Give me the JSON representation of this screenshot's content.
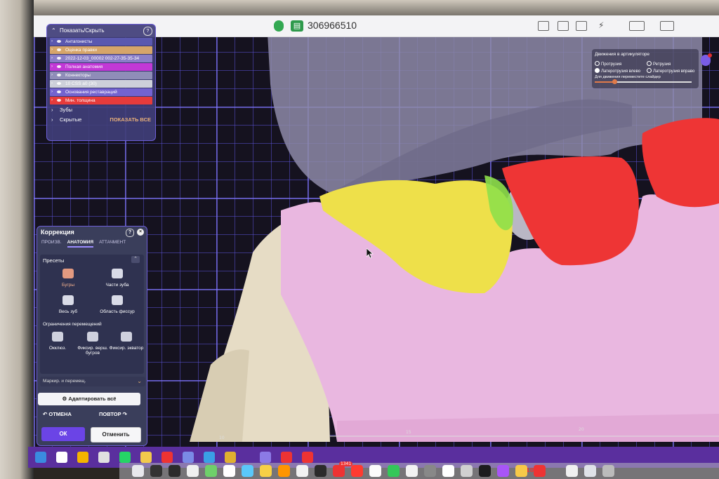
{
  "topbar": {
    "session_id": "306966510"
  },
  "visibility_panel": {
    "title": "Показать/Скрыть",
    "help": "?",
    "rows": [
      {
        "label": "Антагонисты",
        "color": "#5a58b0"
      },
      {
        "label": "Оценка правки",
        "color": "#d6a56a"
      },
      {
        "label": "2022-12-03_00002 002-27-35-35-34",
        "color": "#8a7ec8"
      },
      {
        "label": "Полная анатомия",
        "color": "#c239d6"
      },
      {
        "label": "Коннекторы",
        "color": "#8f8db8"
      },
      {
        "label": "10 CSS a0 (30)",
        "color": "#cdd0da"
      },
      {
        "label": "Основания реставраций",
        "color": "#7363d0"
      },
      {
        "label": "Мин. толщина",
        "color": "#e63b3b"
      }
    ],
    "teeth_label": "Зубы",
    "hidden_label": "Скрытые",
    "show_all_label": "ПОКАЗАТЬ ВСЕ"
  },
  "correction_panel": {
    "title": "Коррекция",
    "help": "?",
    "close": "×",
    "tabs": [
      {
        "label": "ПРОИЗВ.",
        "active": false
      },
      {
        "label": "АНАТОМИЯ",
        "active": true
      },
      {
        "label": "АТТАЧМЕНТ",
        "active": false
      }
    ],
    "presets_label": "Пресеты",
    "presets": [
      {
        "label": "Бугры",
        "icon": "cusps-icon",
        "selected": true
      },
      {
        "label": "Части зуба",
        "icon": "tooth-parts-icon",
        "selected": false
      },
      {
        "label": "Весь зуб",
        "icon": "whole-tooth-icon",
        "selected": false
      },
      {
        "label": "Область фиссур",
        "icon": "fissure-area-icon",
        "selected": false
      }
    ],
    "constraints_label": "Ограничения перемещений",
    "constraints": [
      {
        "label": "Окклюз.",
        "icon": "occlusal-icon"
      },
      {
        "label": "Фиксир. верш. бугров",
        "icon": "fix-cusp-tips-icon"
      },
      {
        "label": "Фиксир. экватор",
        "icon": "fix-equator-icon"
      }
    ],
    "mark_move_label": "Маркир. и перемещ.",
    "adapt_all_label": "Адаптировать всё",
    "undo_label": "ОТМЕНА",
    "redo_label": "ПОВТОР",
    "ok_label": "ОК",
    "cancel_label": "Отменить"
  },
  "motion_panel": {
    "title": "Движения в артикуляторе",
    "options": [
      {
        "label": "Протрузия",
        "selected": false
      },
      {
        "label": "Ретрузия",
        "selected": false
      },
      {
        "label": "Латеротрузия влево",
        "selected": true
      },
      {
        "label": "Латеротрузия вправо",
        "selected": false
      }
    ],
    "slider_label": "Для движения переместите слайдер",
    "slider_value": 0.2
  },
  "scene": {
    "ruler_labels": [
      "10",
      "15",
      "20"
    ],
    "colors": {
      "gingiva": "#e9b7e0",
      "tooth_yellow": "#eee04a",
      "tooth_red": "#ee3535",
      "model_base": "#e6dcc5"
    }
  },
  "win_taskbar": {
    "icons": [
      "windows-start-icon",
      "search-icon",
      "app-icon",
      "chat-icon",
      "whatsapp-icon",
      "folder-icon",
      "yandex-icon",
      "app-icon",
      "photos-icon",
      "app-icon",
      "dental-app-icon",
      "app-icon",
      "app-icon"
    ]
  },
  "dock": {
    "badge": "1341",
    "calendar_day": "10"
  }
}
